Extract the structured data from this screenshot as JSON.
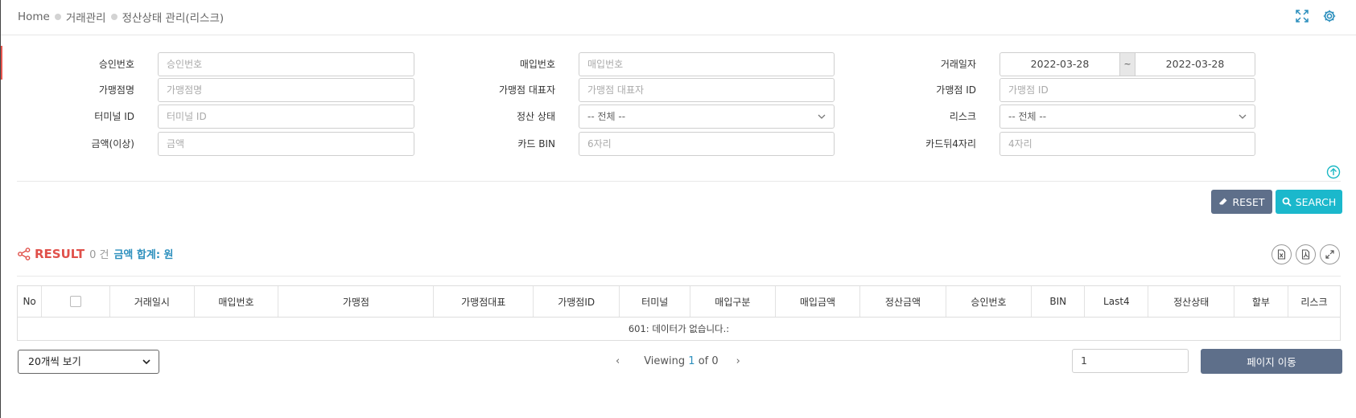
{
  "breadcrumb": {
    "home": "Home",
    "section": "거래관리",
    "page": "정산상태 관리(리스크)"
  },
  "header": {
    "expand_icon": "fullscreen-icon",
    "settings_icon": "gear-icon"
  },
  "form": {
    "approval_no": {
      "label": "승인번호",
      "placeholder": "승인번호"
    },
    "merchant_name": {
      "label": "가맹점명",
      "placeholder": "가맹점명"
    },
    "terminal_id": {
      "label": "터미널 ID",
      "placeholder": "터미널 ID"
    },
    "amount_min": {
      "label": "금액(이상)",
      "placeholder": "금액"
    },
    "purchase_no": {
      "label": "매입번호",
      "placeholder": "매입번호"
    },
    "merchant_rep": {
      "label": "가맹점 대표자",
      "placeholder": "가맹점 대표자"
    },
    "settle_status": {
      "label": "정산 상태",
      "value": "-- 전체 --"
    },
    "card_bin": {
      "label": "카드 BIN",
      "placeholder": "6자리"
    },
    "trade_date": {
      "label": "거래일자",
      "from": "2022-03-28",
      "sep": "~",
      "to": "2022-03-28"
    },
    "merchant_id": {
      "label": "가맹점 ID",
      "placeholder": "가맹점 ID"
    },
    "risk": {
      "label": "리스크",
      "value": "-- 전체 --"
    },
    "card_last4": {
      "label": "카드뒤4자리",
      "placeholder": "4자리"
    }
  },
  "buttons": {
    "reset": "RESET",
    "search": "SEARCH"
  },
  "result": {
    "title": "RESULT",
    "count": "0 건",
    "sum_label": "금액 합계: 원"
  },
  "table": {
    "columns": [
      "No",
      "",
      "거래일시",
      "매입번호",
      "가맹점",
      "가맹점대표",
      "가맹점ID",
      "터미널",
      "매입구분",
      "매입금액",
      "정산금액",
      "승인번호",
      "BIN",
      "Last4",
      "정산상태",
      "할부",
      "리스크"
    ],
    "empty_message": "601: 데이터가 없습니다.:"
  },
  "footer": {
    "page_size": "20개씩 보기",
    "viewing_prefix": "Viewing",
    "current_page": "1",
    "of_text": "of 0",
    "goto_value": "1",
    "goto_button": "페이지 이동"
  },
  "colors": {
    "accent": "#1bb8cc",
    "primary_dark": "#5e6f8a",
    "result_red": "#e0504a",
    "link_blue": "#2c8fbd"
  }
}
